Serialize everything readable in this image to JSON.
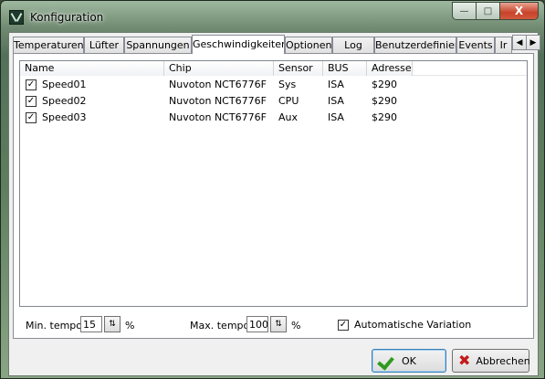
{
  "window": {
    "title": "Konfiguration"
  },
  "caption_buttons": {
    "minimize": "—",
    "maximize": "□",
    "close": "X"
  },
  "tabs": [
    {
      "label": "Temperaturen"
    },
    {
      "label": "Lüfter"
    },
    {
      "label": "Spannungen"
    },
    {
      "label": "Geschwindigkeiten"
    },
    {
      "label": "Optionen"
    },
    {
      "label": "Log"
    },
    {
      "label": "Benutzerdefiniert"
    },
    {
      "label": "Events"
    },
    {
      "label": "Ir"
    }
  ],
  "active_tab": "Geschwindigkeiten",
  "tab_scroll": {
    "left": "◀",
    "right": "▶"
  },
  "list": {
    "columns": [
      "Name",
      "Chip",
      "Sensor",
      "BUS",
      "Adresse"
    ],
    "rows": [
      {
        "checked": true,
        "check": "✓",
        "name": "Speed01",
        "chip": "Nuvoton NCT6776F",
        "sensor": "Sys",
        "bus": "ISA",
        "address": "$290"
      },
      {
        "checked": true,
        "check": "✓",
        "name": "Speed02",
        "chip": "Nuvoton NCT6776F",
        "sensor": "CPU",
        "bus": "ISA",
        "address": "$290"
      },
      {
        "checked": true,
        "check": "✓",
        "name": "Speed03",
        "chip": "Nuvoton NCT6776F",
        "sensor": "Aux",
        "bus": "ISA",
        "address": "$290"
      }
    ]
  },
  "options": {
    "min_tempo_label": "Min. tempo",
    "min_tempo_value": "15",
    "max_tempo_label": "Max. tempo",
    "max_tempo_value": "100",
    "percent": "%",
    "auto_variation_label": "Automatische Variation",
    "auto_variation_checked": true,
    "check": "✓",
    "spin": "⇅"
  },
  "buttons": {
    "ok": "OK",
    "cancel": "Abbrechen"
  },
  "icons": {
    "ok": "check-icon",
    "cancel": "x-icon"
  }
}
